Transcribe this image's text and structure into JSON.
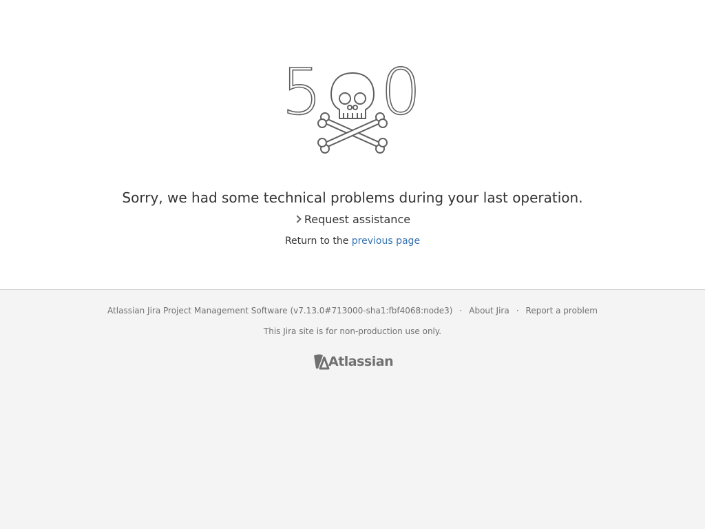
{
  "error": {
    "code_first_digit": "5",
    "code_last_digit": "0",
    "graphic_icon": "skull-and-crossbones-icon",
    "headline": "Sorry, we had some technical problems during your last operation.",
    "request_assistance": "Request assistance",
    "return_prefix": "Return to the",
    "return_link": "previous page"
  },
  "footer": {
    "software": "Atlassian Jira Project Management Software (v7.13.0#713000-sha1:fbf4068:node3)",
    "separator": "·",
    "about": "About Jira",
    "report": "Report a problem",
    "note": "This Jira site is for non-production use only.",
    "brand": "Atlassian",
    "brand_icon": "atlassian-logo-icon"
  },
  "colors": {
    "link": "#3572b0",
    "footer_bg": "#f4f4f4",
    "footer_text": "#707070",
    "graphic_stroke": "#606060"
  }
}
